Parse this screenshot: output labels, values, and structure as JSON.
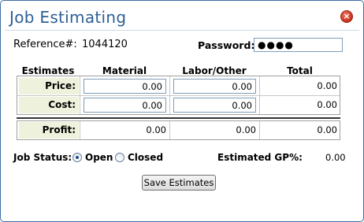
{
  "dialog": {
    "title": "Job Estimating",
    "close_glyph": "×",
    "close_icon": "close-icon"
  },
  "reference": {
    "label": "Reference#:",
    "value": "1044120"
  },
  "password": {
    "label": "Password:",
    "value": "●●●●"
  },
  "columns": [
    "Estimates",
    "Material",
    "Labor/Other",
    "Total"
  ],
  "rows": {
    "price": {
      "label": "Price:",
      "material": "0.00",
      "labor": "0.00",
      "total": "0.00"
    },
    "cost": {
      "label": "Cost:",
      "material": "0.00",
      "labor": "0.00",
      "total": "0.00"
    },
    "profit": {
      "label": "Profit:",
      "material": "0.00",
      "labor": "0.00",
      "total": "0.00"
    }
  },
  "job_status": {
    "label": "Job Status:",
    "options": [
      {
        "label": "Open",
        "selected": true
      },
      {
        "label": "Closed",
        "selected": false
      }
    ]
  },
  "gp": {
    "label": "Estimated GP%:",
    "value": "0.00"
  },
  "save_button": {
    "label": "Save Estimates"
  },
  "colors": {
    "title": "#2e5f95",
    "row_label_bg": "#eef2dc",
    "close": "#c8301c"
  }
}
